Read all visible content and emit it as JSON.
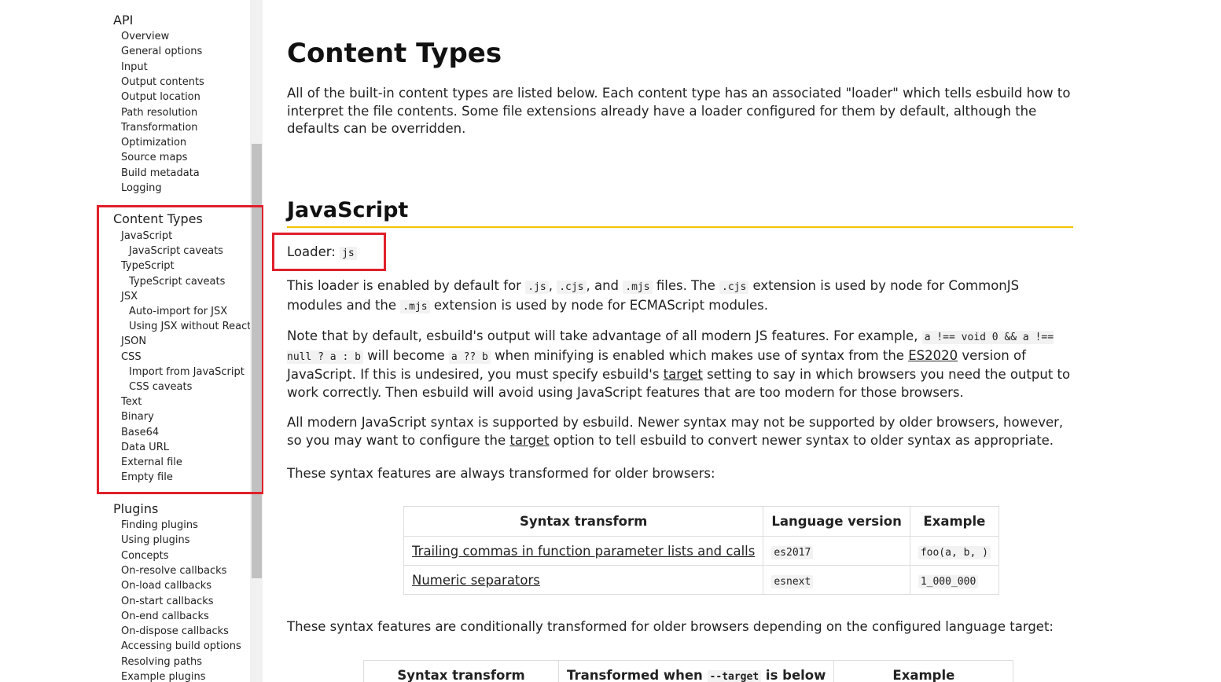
{
  "sidebar": {
    "api": {
      "title": "API",
      "items": [
        "Overview",
        "General options",
        "Input",
        "Output contents",
        "Output location",
        "Path resolution",
        "Transformation",
        "Optimization",
        "Source maps",
        "Build metadata",
        "Logging"
      ]
    },
    "content_types": {
      "title": "Content Types",
      "items": [
        {
          "label": "JavaScript",
          "level": 1
        },
        {
          "label": "JavaScript caveats",
          "level": 2
        },
        {
          "label": "TypeScript",
          "level": 1
        },
        {
          "label": "TypeScript caveats",
          "level": 2
        },
        {
          "label": "JSX",
          "level": 1
        },
        {
          "label": "Auto-import for JSX",
          "level": 2
        },
        {
          "label": "Using JSX without React",
          "level": 2
        },
        {
          "label": "JSON",
          "level": 1
        },
        {
          "label": "CSS",
          "level": 1
        },
        {
          "label": "Import from JavaScript",
          "level": 2
        },
        {
          "label": "CSS caveats",
          "level": 2
        },
        {
          "label": "Text",
          "level": 1
        },
        {
          "label": "Binary",
          "level": 1
        },
        {
          "label": "Base64",
          "level": 1
        },
        {
          "label": "Data URL",
          "level": 1
        },
        {
          "label": "External file",
          "level": 1
        },
        {
          "label": "Empty file",
          "level": 1
        }
      ]
    },
    "plugins": {
      "title": "Plugins",
      "items": [
        "Finding plugins",
        "Using plugins",
        "Concepts",
        "On-resolve callbacks",
        "On-load callbacks",
        "On-start callbacks",
        "On-end callbacks",
        "On-dispose callbacks",
        "Accessing build options",
        "Resolving paths",
        "Example plugins"
      ]
    }
  },
  "main": {
    "title": "Content Types",
    "intro": "All of the built-in content types are listed below. Each content type has an associated \"loader\" which tells esbuild how to interpret the file contents. Some file extensions already have a loader configured for them by default, although the defaults can be overridden.",
    "js_heading": "JavaScript",
    "loader_label": "Loader:",
    "loader_value": "js",
    "p1": {
      "t1": "This loader is enabled by default for ",
      "c1": ".js",
      "t2": ", ",
      "c2": ".cjs",
      "t3": ", and ",
      "c3": ".mjs",
      "t4": " files. The ",
      "c4": ".cjs",
      "t5": " extension is used by node for CommonJS modules and the ",
      "c5": ".mjs",
      "t6": " extension is used by node for ECMAScript modules."
    },
    "p2": {
      "t1": "Note that by default, esbuild's output will take advantage of all modern JS features. For example, ",
      "c1": "a !== void 0 && a !== null ? a : b",
      "t2": " will become ",
      "c2": "a ?? b",
      "t3": " when minifying is enabled which makes use of syntax from the ",
      "l1": "ES2020",
      "t4": " version of JavaScript. If this is undesired, you must specify esbuild's ",
      "l2": "target",
      "t5": " setting to say in which browsers you need the output to work correctly. Then esbuild will avoid using JavaScript features that are too modern for those browsers."
    },
    "p3": {
      "t1": "All modern JavaScript syntax is supported by esbuild. Newer syntax may not be supported by older browsers, however, so you may want to configure the ",
      "l1": "target",
      "t2": " option to tell esbuild to convert newer syntax to older syntax as appropriate."
    },
    "p4": "These syntax features are always transformed for older browsers:",
    "table1": {
      "headers": [
        "Syntax transform",
        "Language version",
        "Example"
      ],
      "rows": [
        {
          "feature": "Trailing commas in function parameter lists and calls",
          "version": "es2017",
          "example": "foo(a, b, )"
        },
        {
          "feature": "Numeric separators",
          "version": "esnext",
          "example": "1_000_000"
        }
      ]
    },
    "p5": "These syntax features are conditionally transformed for older browsers depending on the configured language target:",
    "table2": {
      "h1": "Syntax transform",
      "h2_before": "Transformed when ",
      "h2_code": "--target",
      "h2_after": " is below",
      "h3": "Example"
    }
  }
}
